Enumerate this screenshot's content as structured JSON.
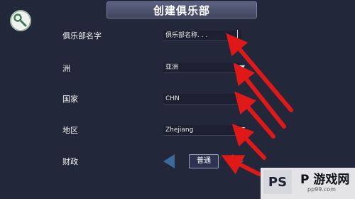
{
  "title": "创建俱乐部",
  "rows": [
    {
      "label": "俱乐部名字",
      "value": "俱乐部名称. . ."
    },
    {
      "label": "洲",
      "value": "亚洲"
    },
    {
      "label": "国家",
      "value": "CHN"
    },
    {
      "label": "地区",
      "value": "Zhejiang"
    },
    {
      "label": "财政",
      "value": "普通"
    }
  ],
  "icons": {
    "tool": "wrench-icon",
    "dropdown": "triangle-down-icon",
    "budget_prev": "arrow-left-icon",
    "budget_next": "arrow-right-icon"
  },
  "colors": {
    "background": "#23273a",
    "title_bar": "#4f5470",
    "annotation_arrow": "#e01818",
    "selector_arrow": "#3a6a9a"
  },
  "watermark": {
    "logo": "PS",
    "text": "P 游戏网",
    "url": "pp99.com"
  }
}
